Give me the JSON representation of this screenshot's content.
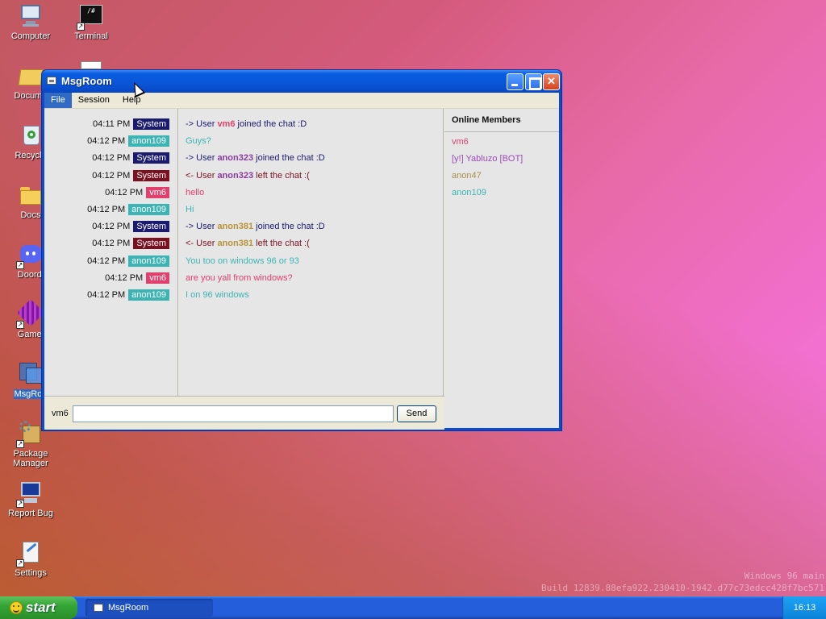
{
  "desktop": {
    "icons": [
      {
        "label": "Computer",
        "icon": "computer-icon"
      },
      {
        "label": "Terminal",
        "icon": "terminal-icon"
      },
      {
        "label": "Docume",
        "icon": "documents-folder-icon"
      },
      {
        "label": "Recycle",
        "icon": "recycle-bin-icon"
      },
      {
        "label": "Docs",
        "icon": "folder-icon"
      },
      {
        "label": "Doordi",
        "icon": "discord-icon"
      },
      {
        "label": "Gamei",
        "icon": "game-icon"
      },
      {
        "label": "MsgRoo",
        "icon": "msgroom-icon"
      },
      {
        "label": "Package Manager",
        "icon": "package-icon"
      },
      {
        "label": "Report Bug",
        "icon": "bug-report-icon"
      },
      {
        "label": "Settings",
        "icon": "settings-icon"
      }
    ]
  },
  "window": {
    "title": "MsgRoom",
    "menu": [
      "File",
      "Session",
      "Help"
    ]
  },
  "messages": [
    {
      "time": "04:11 PM",
      "tag": "System",
      "parts": [
        "-> User ",
        "vm6",
        " joined the chat :D"
      ]
    },
    {
      "time": "04:12 PM",
      "tag": "anon109",
      "text": "Guys?"
    },
    {
      "time": "04:12 PM",
      "tag": "System",
      "parts": [
        "-> User ",
        "anon323",
        " joined the chat :D"
      ]
    },
    {
      "time": "04:12 PM",
      "tag": "System",
      "parts": [
        "<- User ",
        "anon323",
        " left the chat :("
      ]
    },
    {
      "time": "04:12 PM",
      "tag": "vm6",
      "text": "hello"
    },
    {
      "time": "04:12 PM",
      "tag": "anon109",
      "text": "Hi"
    },
    {
      "time": "04:12 PM",
      "tag": "System",
      "parts": [
        "-> User ",
        "anon381",
        " joined the chat :D"
      ]
    },
    {
      "time": "04:12 PM",
      "tag": "System",
      "parts": [
        "<- User ",
        "anon381",
        " left the chat :("
      ]
    },
    {
      "time": "04:12 PM",
      "tag": "anon109",
      "text": "You too on windows 96 or 93"
    },
    {
      "time": "04:12 PM",
      "tag": "vm6",
      "text": "are you yall from windows?"
    },
    {
      "time": "04:12 PM",
      "tag": "anon109",
      "text": "I on 96 windows"
    }
  ],
  "colors": {
    "system_join": "#1a1a6e",
    "system_leave": "#7a1020",
    "anon109": "#3cb4b4",
    "vm6": "#e0406e",
    "anon323": "#8a3aa0",
    "anon381": "#b89438",
    "yabluzo": "#9a4ab8",
    "anon47": "#a8904a"
  },
  "online": {
    "title": "Online Members",
    "members": [
      "vm6",
      "[y!] Yabluzo [BOT]",
      "anon47",
      "anon109"
    ]
  },
  "input": {
    "nick": "vm6",
    "value": "",
    "send_label": "Send"
  },
  "watermark": {
    "line1": "Windows 96 main",
    "line2": "Build 12839.88efa922.230410-1942.d77c73edcc428f7bc571"
  },
  "taskbar": {
    "start_label": "start",
    "task": "MsgRoom",
    "clock": "16:13"
  }
}
